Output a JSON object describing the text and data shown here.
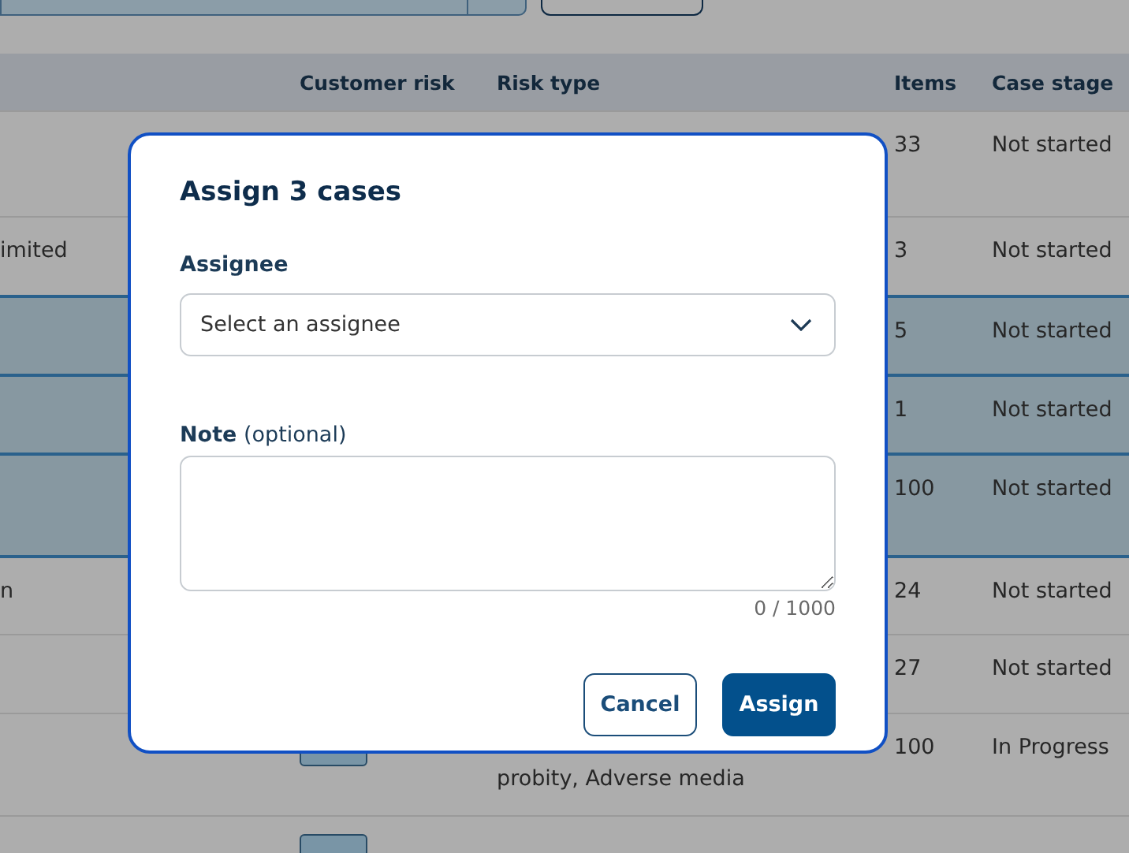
{
  "table": {
    "columns": [
      {
        "label": "Customer risk"
      },
      {
        "label": "Risk type"
      },
      {
        "label": "Items"
      },
      {
        "label": "Case stage"
      }
    ],
    "rows": [
      {
        "selected": false,
        "items": "33",
        "case_stage": "Not started"
      },
      {
        "selected": false,
        "column_1": "imited",
        "items": "3",
        "case_stage": "Not started"
      },
      {
        "selected": true,
        "items": "5",
        "case_stage": "Not started"
      },
      {
        "selected": true,
        "items": "1",
        "case_stage": "Not started"
      },
      {
        "selected": true,
        "items": "100",
        "case_stage": "Not started"
      },
      {
        "selected": false,
        "column_1": "n",
        "items": "24",
        "case_stage": "Not started"
      },
      {
        "selected": false,
        "items": "27",
        "case_stage": "Not started"
      },
      {
        "selected": false,
        "risk_badge": true,
        "risk_type": "probity, Adverse media",
        "items": "100",
        "case_stage": "In Progress"
      },
      {
        "selected": false,
        "risk_badge": true
      }
    ]
  },
  "modal": {
    "title": "Assign 3 cases",
    "assignee": {
      "label": "Assignee",
      "placeholder": "Select an assignee"
    },
    "note": {
      "label": "**Note** (optional)",
      "counter": "0 / 1000"
    },
    "buttons": [
      {
        "label": "Cancel",
        "kind": "secondary"
      },
      {
        "label": "Assign",
        "kind": "primary"
      }
    ]
  }
}
